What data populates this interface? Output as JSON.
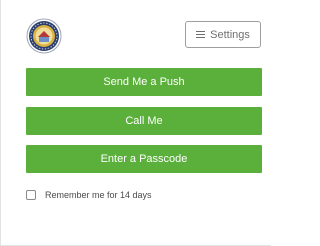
{
  "settings": {
    "label": "Settings",
    "icon": "hamburger-icon"
  },
  "actions": {
    "push_label": "Send Me a Push",
    "call_label": "Call Me",
    "passcode_label": "Enter a Passcode"
  },
  "remember": {
    "label": "Remember me for 14 days",
    "checked": false
  },
  "colors": {
    "accent_green": "#5ab03b",
    "logo_navy": "#2c3f72",
    "logo_gold": "#d9b341"
  },
  "logo": {
    "icon": "seal-logo-icon"
  }
}
